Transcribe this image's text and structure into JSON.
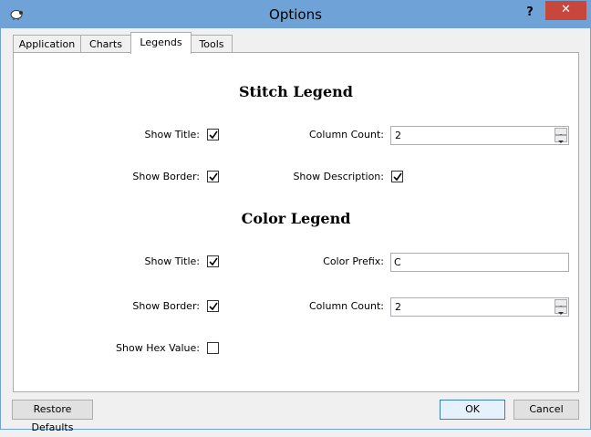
{
  "window": {
    "title": "Options",
    "help_label": "?",
    "close_label": "✕"
  },
  "tabs": [
    {
      "label": "Application"
    },
    {
      "label": "Charts"
    },
    {
      "label": "Legends"
    },
    {
      "label": "Tools"
    }
  ],
  "active_tab": "Legends",
  "stitch_legend": {
    "heading": "Stitch Legend",
    "show_title_label": "Show Title:",
    "show_title_checked": true,
    "show_border_label": "Show Border:",
    "show_border_checked": true,
    "column_count_label": "Column Count:",
    "column_count_value": "2",
    "show_description_label": "Show Description:",
    "show_description_checked": true
  },
  "color_legend": {
    "heading": "Color Legend",
    "show_title_label": "Show Title:",
    "show_title_checked": true,
    "show_border_label": "Show Border:",
    "show_border_checked": true,
    "show_hex_label": "Show Hex Value:",
    "show_hex_checked": false,
    "color_prefix_label": "Color Prefix:",
    "color_prefix_value": "C",
    "column_count_label": "Column Count:",
    "column_count_value": "2"
  },
  "footer": {
    "restore_label": "Restore Defaults",
    "ok_label": "OK",
    "cancel_label": "Cancel"
  },
  "colors": {
    "titlebar": "#6fa3d8",
    "close": "#c7473c"
  }
}
